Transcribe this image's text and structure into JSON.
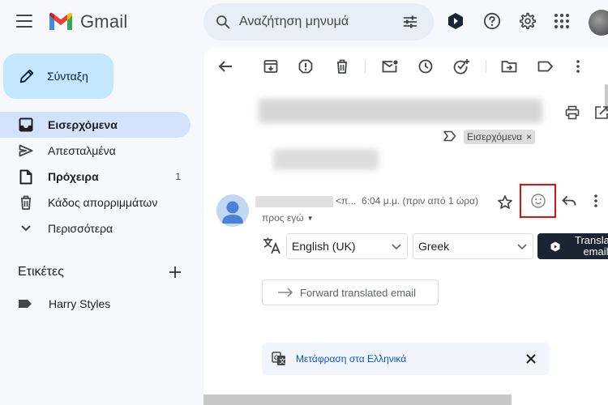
{
  "header": {
    "app_name": "Gmail",
    "search_placeholder": "Αναζήτηση μηνυμά"
  },
  "compose": {
    "label": "Σύνταξη"
  },
  "sidebar": {
    "items": [
      {
        "label": "Εισερχόμενα",
        "count": ""
      },
      {
        "label": "Απεσταλμένα",
        "count": ""
      },
      {
        "label": "Πρόχειρα",
        "count": "1"
      },
      {
        "label": "Κάδος απορριμμάτων",
        "count": ""
      },
      {
        "label": "Περισσότερα",
        "count": ""
      }
    ],
    "labels_title": "Ετικέτες",
    "labels": [
      {
        "name": "Harry Styles"
      }
    ]
  },
  "message": {
    "label_chip": "Εισερχόμενα",
    "label_chip_close": "×",
    "sender_trunc": "<π...",
    "time": "6:04 μ.μ. (πριν από 1 ώρα)",
    "to_me": "προς εγώ"
  },
  "translate": {
    "source_language": "English (UK)",
    "target_language": "Greek",
    "button_label": "Translate email",
    "forward_label": "Forward translated email"
  },
  "translate_bar": {
    "link": "Μετάφραση στα Ελληνικά"
  },
  "colors": {
    "compose_bg": "#c2e7ff",
    "active_nav_bg": "#d3e3fd",
    "highlight_box": "#e01010",
    "translate_button_bg": "#1a2433",
    "link": "#0b57d0"
  }
}
